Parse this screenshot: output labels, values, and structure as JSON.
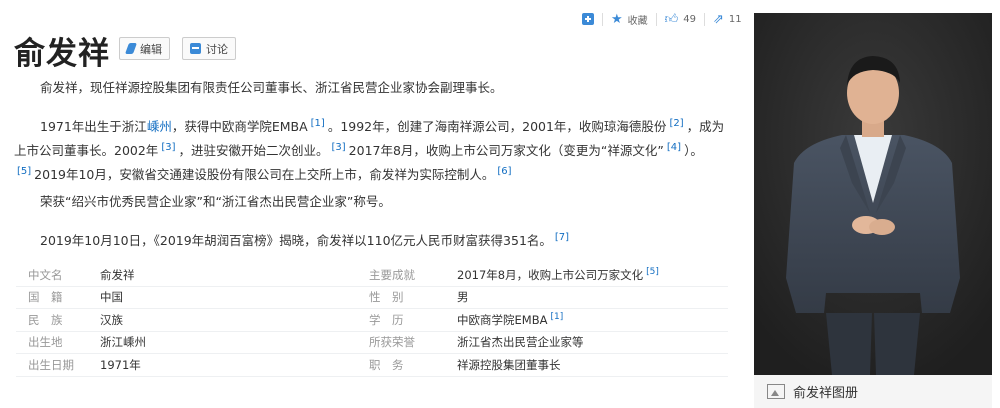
{
  "actions": {
    "collect_label": "收藏",
    "like_count": "49",
    "share_count": "11"
  },
  "title": "俞发祥",
  "edit_label": "编辑",
  "discuss_label": "讨论",
  "paragraphs": {
    "p1": "俞发祥，现任祥源控股集团有限责任公司董事长、浙江省民营企业家协会副理事长。",
    "p2_a": "1971年出生于浙江",
    "p2_link": "嵊州",
    "p2_b": "，获得中欧商学院EMBA",
    "ref1": "[1]",
    "p2_c": "。1992年，创建了海南祥源公司，2001年，收购琼海德股份",
    "ref2": "[2]",
    "p2_d": "，成为上市公司董事长。2002年",
    "ref3": "[3]",
    "p2_e": "，进驻安徽开始二次创业。",
    "ref3b": "[3]",
    "p2_f": "2017年8月，收购上市公司万家文化（变更为“祥源文化”",
    "ref4": "[4]",
    "p2_g": "）。",
    "ref5": "[5]",
    "p2_h": "2019年10月，安徽省交通建设股份有限公司在上交所上市，俞发祥为实际控制人。",
    "ref6": "[6]",
    "p3": "荣获“绍兴市优秀民营企业家”和“浙江省杰出民营企业家”称号。",
    "p4": "2019年10月10日，《2019年胡润百富榜》揭晓，俞发祥以110亿元人民币财富获得351名。",
    "ref7": "[7]"
  },
  "info": [
    {
      "k1": "中文名",
      "v1": "俞发祥",
      "k2": "主要成就",
      "v2": "2017年8月，收购上市公司万家文化",
      "ref": "[5]"
    },
    {
      "k1": "国　籍",
      "v1": "中国",
      "k2": "性　别",
      "v2": "男",
      "ref": ""
    },
    {
      "k1": "民　族",
      "v1": "汉族",
      "k2": "学　历",
      "v2": "中欧商学院EMBA",
      "ref": "[1]"
    },
    {
      "k1": "出生地",
      "v1": "浙江嵊州",
      "k2": "所获荣誉",
      "v2": "浙江省杰出民营企业家等",
      "ref": ""
    },
    {
      "k1": "出生日期",
      "v1": "1971年",
      "k2": "职　务",
      "v2": "祥源控股集团董事长",
      "ref": ""
    }
  ],
  "album_label": "俞发祥图册",
  "colors": {
    "accent": "#3b8ad7",
    "link": "#136ec2"
  }
}
